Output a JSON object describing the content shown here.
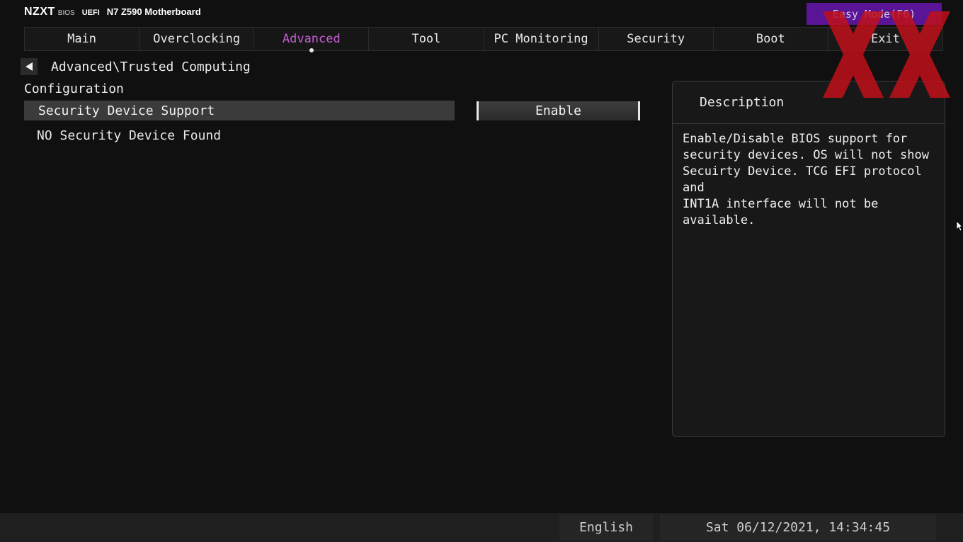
{
  "header": {
    "brand": "NZXT",
    "bios_label": "BIOS",
    "uefi_label": "UEFI",
    "model": "N7 Z590 Motherboard",
    "easy_mode_label": "Easy Mode(F6)"
  },
  "tabs": [
    {
      "label": "Main",
      "active": false
    },
    {
      "label": "Overclocking",
      "active": false
    },
    {
      "label": "Advanced",
      "active": true
    },
    {
      "label": "Tool",
      "active": false
    },
    {
      "label": "PC Monitoring",
      "active": false
    },
    {
      "label": "Security",
      "active": false
    },
    {
      "label": "Boot",
      "active": false
    },
    {
      "label": "Exit",
      "active": false
    }
  ],
  "breadcrumb": "Advanced\\Trusted Computing",
  "section_title": "Configuration",
  "settings": [
    {
      "label": "Security Device Support",
      "value": "Enable"
    }
  ],
  "info_text": "NO Security Device Found",
  "description": {
    "title": "Description",
    "text": "Enable/Disable BIOS support for\nsecurity devices. OS will not show\nSecuirty Device. TCG EFI protocol and\nINT1A interface will not be available."
  },
  "footer": {
    "language": "English",
    "datetime": "Sat 06/12/2021, 14:34:45"
  },
  "colors": {
    "accent": "#c45fd3",
    "easy_mode_bg": "#5a1596",
    "watermark": "#c0101a"
  },
  "icons": {
    "back": "back-arrow-icon",
    "watermark": "xx-watermark-logo",
    "cursor": "mouse-cursor-icon"
  }
}
